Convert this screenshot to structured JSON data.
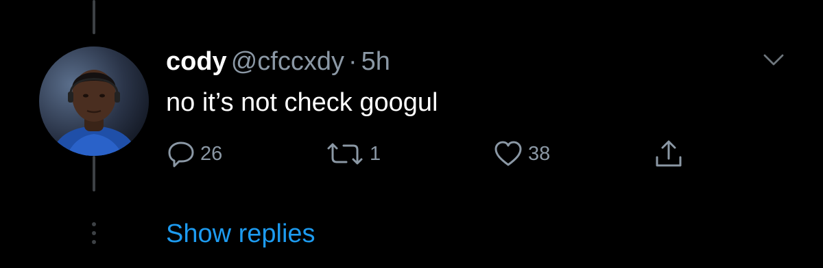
{
  "tweet": {
    "display_name": "cody",
    "handle": "@cfccxdy",
    "separator": "·",
    "time": "5h",
    "text": "no it’s not check googul",
    "avatar_icon": "profile-photo",
    "menu_icon": "chevron-down-icon"
  },
  "actions": {
    "reply": {
      "icon": "reply-icon",
      "count": "26"
    },
    "retweet": {
      "icon": "retweet-icon",
      "count": "1"
    },
    "like": {
      "icon": "heart-icon",
      "count": "38"
    },
    "share": {
      "icon": "share-icon"
    }
  },
  "thread": {
    "show_replies_label": "Show replies"
  },
  "colors": {
    "background": "#000000",
    "primary_text": "#ffffff",
    "secondary_text": "#8b98a5",
    "link": "#1d9bf0",
    "thread_line": "#3d4145"
  }
}
